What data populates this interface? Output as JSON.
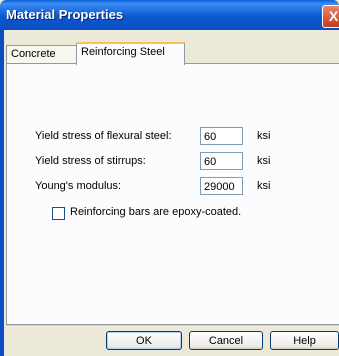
{
  "window": {
    "title": "Material Properties",
    "close_symbol": "X"
  },
  "tabs": [
    {
      "label": "Concrete",
      "active": false
    },
    {
      "label": "Reinforcing Steel",
      "active": true
    }
  ],
  "fields": [
    {
      "label": "Yield stress of flexural steel:",
      "value": "60",
      "unit": "ksi"
    },
    {
      "label": "Yield stress of stirrups:",
      "value": "60",
      "unit": "ksi"
    },
    {
      "label": "Young's modulus:",
      "value": "29000",
      "unit": "ksi"
    }
  ],
  "checkbox": {
    "label": "Reinforcing bars are epoxy-coated.",
    "checked": false
  },
  "buttons": {
    "ok": "OK",
    "cancel": "Cancel",
    "help": "Help"
  }
}
